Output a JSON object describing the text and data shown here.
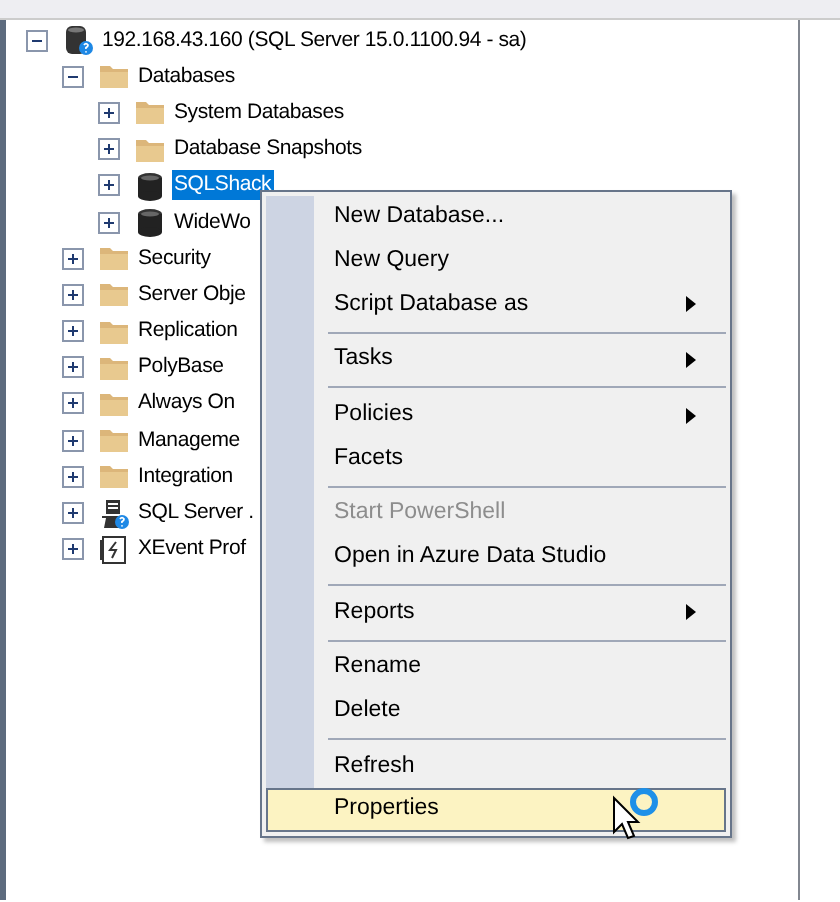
{
  "tree": [
    {
      "label": "192.168.43.160 (SQL Server 15.0.1100.94 - sa)",
      "kind": "server",
      "expanded": true,
      "selected": false,
      "children": [
        {
          "label": "Databases",
          "kind": "folder",
          "expanded": true,
          "selected": false,
          "children": [
            {
              "label": "System Databases",
              "kind": "folder",
              "expanded": false,
              "selected": false
            },
            {
              "label": "Database Snapshots",
              "kind": "folder",
              "expanded": false,
              "selected": false
            },
            {
              "label": "SQLShack",
              "kind": "database",
              "expanded": false,
              "selected": true
            },
            {
              "label": "WideWo",
              "kind": "database",
              "expanded": false,
              "selected": false
            }
          ]
        },
        {
          "label": "Security",
          "kind": "folder",
          "expanded": false,
          "selected": false
        },
        {
          "label": "Server Obje",
          "kind": "folder",
          "expanded": false,
          "selected": false
        },
        {
          "label": "Replication",
          "kind": "folder",
          "expanded": false,
          "selected": false
        },
        {
          "label": "PolyBase",
          "kind": "folder",
          "expanded": false,
          "selected": false
        },
        {
          "label": "Always On",
          "kind": "folder",
          "expanded": false,
          "selected": false
        },
        {
          "label": "Manageme",
          "kind": "folder",
          "expanded": false,
          "selected": false
        },
        {
          "label": "Integration",
          "kind": "folder",
          "expanded": false,
          "selected": false
        },
        {
          "label": "SQL Server .",
          "kind": "agent",
          "expanded": false,
          "selected": false
        },
        {
          "label": "XEvent Prof",
          "kind": "xevent",
          "expanded": false,
          "selected": false
        }
      ]
    }
  ],
  "context_menu": {
    "items": [
      {
        "kind": "item",
        "label": "New Database...",
        "submenu": false,
        "disabled": false,
        "selected": false
      },
      {
        "kind": "item",
        "label": "New Query",
        "submenu": false,
        "disabled": false,
        "selected": false
      },
      {
        "kind": "item",
        "label": "Script Database as",
        "submenu": true,
        "disabled": false,
        "selected": false
      },
      {
        "kind": "separator"
      },
      {
        "kind": "item",
        "label": "Tasks",
        "submenu": true,
        "disabled": false,
        "selected": false
      },
      {
        "kind": "separator"
      },
      {
        "kind": "item",
        "label": "Policies",
        "submenu": true,
        "disabled": false,
        "selected": false
      },
      {
        "kind": "item",
        "label": "Facets",
        "submenu": false,
        "disabled": false,
        "selected": false
      },
      {
        "kind": "separator"
      },
      {
        "kind": "item",
        "label": "Start PowerShell",
        "submenu": false,
        "disabled": true,
        "selected": false
      },
      {
        "kind": "item",
        "label": "Open in Azure Data Studio",
        "submenu": false,
        "disabled": false,
        "selected": false
      },
      {
        "kind": "separator"
      },
      {
        "kind": "item",
        "label": "Reports",
        "submenu": true,
        "disabled": false,
        "selected": false
      },
      {
        "kind": "separator"
      },
      {
        "kind": "item",
        "label": "Rename",
        "submenu": false,
        "disabled": false,
        "selected": false
      },
      {
        "kind": "item",
        "label": "Delete",
        "submenu": false,
        "disabled": false,
        "selected": false
      },
      {
        "kind": "separator"
      },
      {
        "kind": "item",
        "label": "Refresh",
        "submenu": false,
        "disabled": false,
        "selected": false
      },
      {
        "kind": "item",
        "label": "Properties",
        "submenu": false,
        "disabled": false,
        "selected": true
      }
    ]
  }
}
